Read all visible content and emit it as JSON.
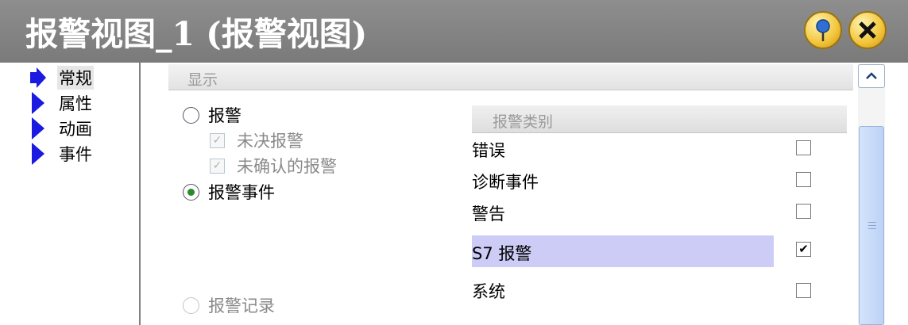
{
  "window": {
    "title": "报警视图_1 (报警视图)"
  },
  "nav": {
    "items": [
      "常规",
      "属性",
      "动画",
      "事件"
    ]
  },
  "section": {
    "title": "显示"
  },
  "display_options": {
    "alarms_label": "报警",
    "unresolved_label": "未决报警",
    "unacknowledged_label": "未确认的报警",
    "alarm_events_label": "报警事件",
    "alarm_log_label": "报警记录"
  },
  "categories": {
    "header": "报警类别",
    "items": [
      {
        "label": "错误",
        "checked": false
      },
      {
        "label": "诊断事件",
        "checked": false
      },
      {
        "label": "警告",
        "checked": false
      },
      {
        "label": "S7 报警",
        "checked": true
      },
      {
        "label": "系统",
        "checked": false
      }
    ]
  },
  "colors": {
    "titlebar": "#808080",
    "selected_row": "#ccccf6",
    "scrollbar_thumb": "#c4d8f8"
  }
}
